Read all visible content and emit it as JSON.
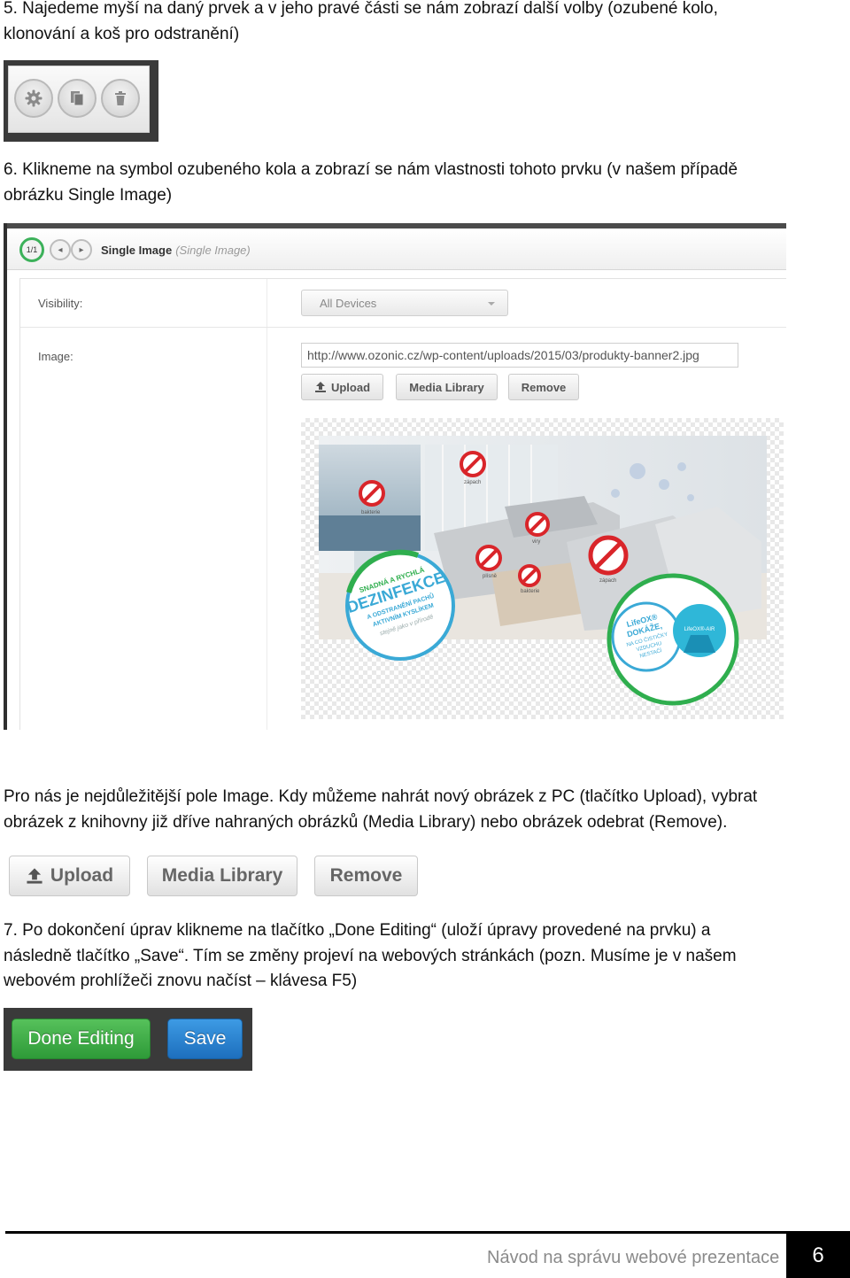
{
  "step5": {
    "line1": "5. Najedeme myší na daný prvek a v jeho pravé části se nám zobrazí další volby (ozubené kolo,",
    "line2": "klonování a koš pro odstranění)",
    "icons": [
      "gear-icon",
      "clone-icon",
      "trash-icon"
    ]
  },
  "step6": {
    "line1": "6. Klikneme na symbol ozubeného kola a zobrazí se nám vlastnosti tohoto prvku (v našem případě",
    "line2": "obrázku Single Image)"
  },
  "editor": {
    "pager_active": "1/1",
    "title": "Single Image",
    "subtitle": "(Single Image)",
    "visibility_label": "Visibility:",
    "visibility_value": "All Devices",
    "image_label": "Image:",
    "image_url": "http://www.ozonic.cz/wp-content/uploads/2015/03/produkty-banner2.jpg",
    "buttons": {
      "upload": "Upload",
      "media_library": "Media Library",
      "remove": "Remove"
    }
  },
  "banner": {
    "badge_left": [
      "SNADNÁ A RYCHLÁ",
      "DEZINFEKCE",
      "A ODSTRANĚNÍ PACHŮ",
      "AKTIVNÍM KYSLÍKEM",
      "stejně jako v přírodě"
    ],
    "badge_right": [
      "LifeOX®",
      "DOKÁŽE,",
      "NA CO ČISTIČKY",
      "VZDUCHU",
      "NESTAČÍ"
    ],
    "device_label": "LifeOX®-AIR",
    "tags": [
      "bakterie",
      "zápach",
      "viry",
      "plísně",
      "bakterie",
      "zápach"
    ]
  },
  "paragraph": {
    "line1": "Pro nás je nejdůležitější pole Image. Kdy můžeme nahrát nový obrázek z PC (tlačítko Upload), vybrat",
    "line2": "obrázek z knihovny již dříve nahraných obrázků (Media Library) nebo obrázek odebrat (Remove)."
  },
  "big_buttons": {
    "upload": "Upload",
    "media_library": "Media Library",
    "remove": "Remove"
  },
  "step7": {
    "line1": "7. Po dokončení úprav klikneme na tlačítko „Done Editing“ (uloží úpravy provedené na prvku) a",
    "line2": "následně tlačítko „Save“. Tím se změny projeví na webových stránkách (pozn. Musíme je v našem",
    "line3": "webovém prohlížeči znovu načíst – klávesa F5)",
    "done_label": "Done Editing",
    "save_label": "Save"
  },
  "footer": {
    "text": "Návod na správu webové prezentace",
    "page": "6"
  },
  "colors": {
    "green": "#3cb15a",
    "blue": "#2a84d2",
    "dark": "#3a3a3a"
  }
}
